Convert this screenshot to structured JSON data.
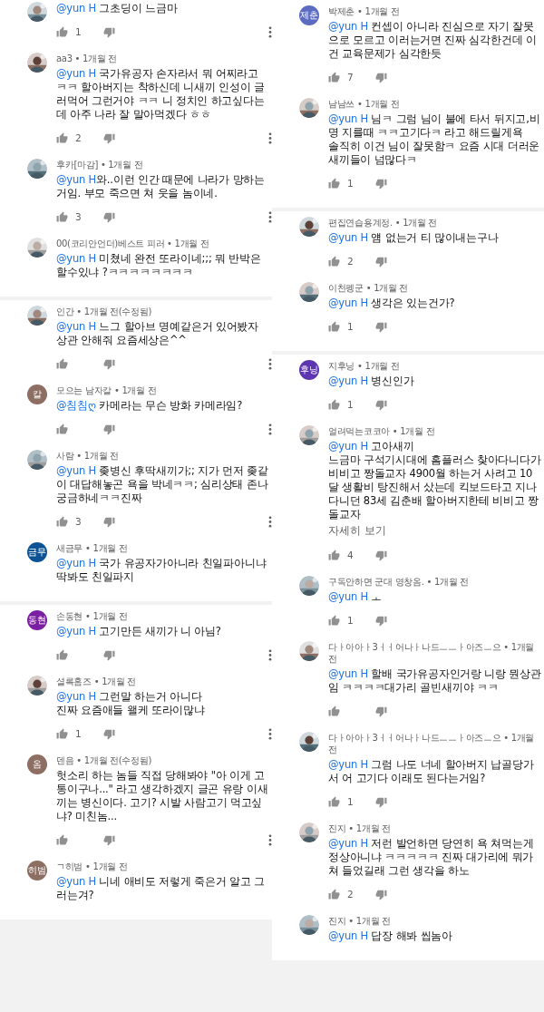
{
  "columns": [
    {
      "menu_icons": true,
      "panels": [
        {
          "comments": [
            {
              "mention": "@yun H",
              "text": " 그초딩이 느금마",
              "likes": "1"
            },
            {
              "author": "aa3",
              "time": "• 1개월 전",
              "mention": "@yun H",
              "text": " 국가유공자 손자라서 뭐 어찌라고 ㅋㅋ 할아버지는 착하신데 니새끼 인성이 글러먹어 그런거야 ㅋㅋ 니 정치인 하고싶다는데 아주 나라 잘 말아먹겠다 ㅎㅎ",
              "likes": "2"
            },
            {
              "author": "후카[마감]",
              "time": "• 1개월 전",
              "mention": "@yun H",
              "text": "와..이런 인간 때문에 나라가 망하는거임. 부모 죽으면 쳐 웃을 놈이네.",
              "likes": "3"
            },
            {
              "author": "00(코리안언더)베스트 피러",
              "time": "• 1개월 전",
              "mention": "@yun H",
              "text": " 미쳤네 완전 또라이네;;; 뭐 반박은 할수있냐 ?ㅋㅋㅋㅋㅋㅋㅋㅋ",
              "actions": false
            }
          ]
        },
        {
          "comments": [
            {
              "author": "인간",
              "time": "• 1개월 전(수정됨)",
              "mention": "@yun H",
              "text": " 느그 할아브 명예같은거 있어봤자 상관 안해줘 요즘세상은^^"
            },
            {
              "author": "모으는 남자칼",
              "time": "• 1개월 전",
              "avatar": {
                "kind": "initials",
                "label": "칼",
                "color": "#8d6e63"
              },
              "mention": "@침침ღ",
              "text": " 카메라는 무슨 방화 카메라임?"
            },
            {
              "author": "사람",
              "time": "• 1개월 전",
              "mention": "@yun H",
              "text": " 좆병신 후딱새끼가;; 지가 먼저 좆같이 대답해놓곤 욕을 박네ㅋㅋ; 심리상태 존나 궁금하네ㅋㅋ진짜",
              "likes": "3"
            },
            {
              "author": "새금무",
              "time": "• 1개월 전",
              "avatar": {
                "kind": "initials",
                "label": "금무",
                "color": "#0b5394"
              },
              "mention": "@yun H",
              "text": " 국가 유공자가아니라 친일파아니냐 딱봐도 친일파지",
              "actions": false
            }
          ]
        },
        {
          "comments": [
            {
              "author": "손동현",
              "time": "• 1개월 전",
              "avatar": {
                "kind": "initials",
                "label": "동현",
                "color": "#7b1fa2"
              },
              "mention": "@yun H",
              "text": " 고기만든 새끼가 니 아님?"
            },
            {
              "author": "셜록홈즈",
              "time": "• 1개월 전",
              "mention": "@yun H",
              "text": " 그런말 하는거 아니다\n진짜 요즘애들 왤케 또라이많냐",
              "likes": "1"
            },
            {
              "author": "덴음",
              "time": "• 1개월 전(수정됨)",
              "avatar": {
                "kind": "initials",
                "label": "옴",
                "color": "#8d6e63"
              },
              "text": "헛소리 하는 놈들 직접 당해봐야 \"아 이게 고통이구나...\" 라고 생각하겠지 글곤 유랑 이새끼는 병신이다. 고기? 시발 사람고기 먹고싶냐? 미친놈..."
            },
            {
              "author": "ㄱ히범",
              "time": "• 1개월 전",
              "avatar": {
                "kind": "initials",
                "label": "히범",
                "color": "#8d6e63"
              },
              "mention": "@yun H",
              "text": " 니네 애비도 저렇게 죽은거 알고 그러는겨?",
              "actions": false
            }
          ]
        }
      ]
    },
    {
      "menu_icons": false,
      "panels": [
        {
          "comments": [
            {
              "author": "박제춘",
              "time": "• 1개월 전",
              "avatar": {
                "kind": "initials",
                "label": "제춘",
                "color": "#5c6bc0"
              },
              "mention": "@yun H",
              "text": " 컨셉이 아니라 진심으로 자기 잘못으로 모르고 이러는거면 진짜 심각한건데 이건 교육문제가 심각한듯",
              "likes": "7"
            },
            {
              "author": "남남쓰",
              "time": "• 1개월 전",
              "mention": "@yun H",
              "text": " 님ㅋ 그럼 님이 불에 타서 뒤지고,비명 지를때 ㅋㅋ고기다ㅋ  라고 해드릴게욕\n솔직히 이건 님이 잘못함ㅋ 요즘 시대 더러운 새끼들이 넘많다ㅋ",
              "likes": "1"
            }
          ]
        },
        {
          "comments": [
            {
              "author": "편집연습용계정.",
              "time": "• 1개월 전",
              "mention": "@yun H",
              "text": " 얨 없는거 티 많이내는구나",
              "likes": "2"
            },
            {
              "author": "이천펭군",
              "time": "• 1개월 전",
              "mention": "@yun H",
              "text": " 생각은 있는건가?",
              "likes": "1"
            }
          ]
        },
        {
          "comments": [
            {
              "author": "지후닝",
              "time": "• 1개월 전",
              "avatar": {
                "kind": "initials",
                "label": "후닝",
                "color": "#5e35b1"
              },
              "mention": "@yun H",
              "text": " 병신인가",
              "likes": "1"
            },
            {
              "author": "얼려먹는코코아",
              "time": "• 1개월 전",
              "mention": "@yun H",
              "text": " 고아새끼\n느금마 구석기시대에 홈플러스 찾아다니다가 비비고 짱돌교자 4900월 하는거 사려고 10달 생활비 탕진해서 샀는데 킥보드타고 지나다니던 83세 김춘배 할아버지한테 비비고 짱돌교자",
              "more": "자세히 보기",
              "likes": "4"
            },
            {
              "author": "구독안하면 군대 영창옴.",
              "time": "• 1개월 전",
              "mention": "@yun H",
              "text": " ㅗ",
              "likes": "1"
            },
            {
              "author": "다ㅏ아아ㅏ3ㅓㅓ어나ㅏ나드ㅡㅡㅏ아즈ㅡ으",
              "time": "• 1개월 전",
              "mention": "@yun H",
              "text": " 할배 국가유공자인거랑 니랑 뭔상관임 ㅋㅋㅋㅋ대가리 골빈새끼야 ㅋㅋ"
            },
            {
              "author": "다ㅏ아아ㅏ3ㅓㅓ어나ㅏ나드ㅡㅡㅏ아즈ㅡ으",
              "time": "• 1개월 전",
              "mention": "@yun H",
              "text": " 그럼 나도 너네 할아버지 납골당가서 어 고기다 이래도 된다는거임?",
              "likes": "1"
            },
            {
              "author": "진지",
              "time": "• 1개월 전",
              "mention": "@yun H",
              "text": " 저런 발언하면 당연히 욕 쳐먹는게 정상아니냐 ㅋㅋㅋㅋㅋ 진짜 대가리에 뭐가 쳐 들었길래 그런 생각을 하노",
              "likes": "2"
            },
            {
              "author": "진지",
              "time": "• 1개월 전",
              "mention": "@yun H",
              "text": " 답장 해봐 씹놈아",
              "actions": false
            }
          ]
        }
      ]
    }
  ]
}
